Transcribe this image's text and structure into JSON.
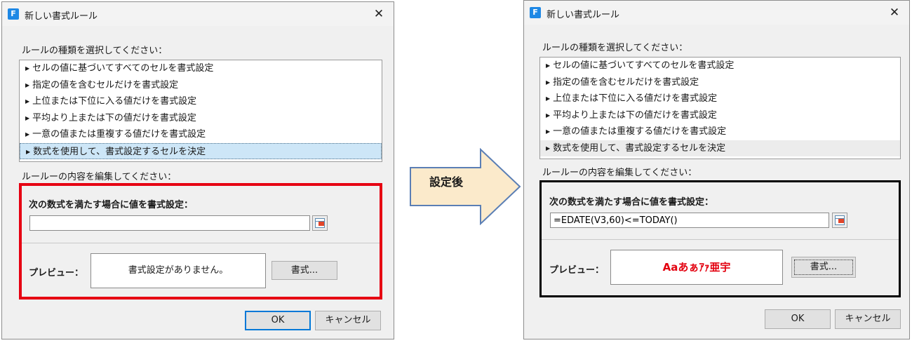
{
  "dialog": {
    "title": "新しい書式ルール",
    "close_glyph": "✕",
    "rule_type_label": "ルールの種類を選択してください：",
    "rule_types": [
      {
        "label": "セルの値に基づいてすべてのセルを書式設定"
      },
      {
        "label": "指定の値を含むセルだけを書式設定"
      },
      {
        "label": "上位または下位に入る値だけを書式設定"
      },
      {
        "label": "平均より上または下の値だけを書式設定"
      },
      {
        "label": "一意の値または重複する値だけを書式設定"
      },
      {
        "label": "数式を使用して、書式設定するセルを決定"
      }
    ],
    "selected_rule_index": 5,
    "edit_label": "ルールーの内容を編集してください：",
    "formula_label": "次の数式を満たす場合に値を書式設定：",
    "preview_label": "プレビュー：",
    "format_button": "書式...",
    "ok_button": "OK",
    "cancel_button": "キャンセル"
  },
  "before": {
    "formula_value": "",
    "preview_text": "書式設定がありません。",
    "highlight_color": "#e60012"
  },
  "after": {
    "formula_value": "=EDATE(V3,60)<=TODAY()",
    "preview_text": "Aaあぁｱｧ亜宇",
    "preview_color": "#e3000f",
    "highlight_color": "#000000"
  },
  "transition": {
    "label": "設定後",
    "arrow_fill": "#fbeacb",
    "arrow_stroke": "#5b7fb5"
  },
  "icons": {
    "app": "app-icon",
    "close": "close-icon",
    "range_ref": "range-reference-icon",
    "bullet": "triangle-right-icon"
  }
}
